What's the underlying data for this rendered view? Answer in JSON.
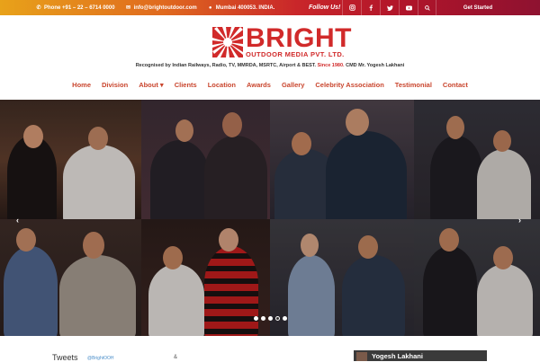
{
  "topbar": {
    "phone": "Phone +91 – 22 – 6714 0000",
    "email": "info@brightoutdoor.com",
    "address": "Mumbai 400053. INDIA.",
    "follow_us": "Follow Us!",
    "socials": [
      "instagram-icon",
      "facebook-icon",
      "twitter-icon",
      "youtube-icon",
      "search-icon"
    ],
    "get_started": "Get Started"
  },
  "header": {
    "brand": "BRIGHT",
    "brand_sub": "OUTDOOR MEDIA PVT. LTD.",
    "tagline_pre": "Recognised by Indian Railways, Radio, TV, MMRDA, MSRTC, Airport & BEST.",
    "tagline_since": "Since 1980.",
    "tagline_post": "CMD Mr. Yogesh Lakhani"
  },
  "nav": {
    "items": [
      "Home",
      "Division",
      "About ▾",
      "Clients",
      "Location",
      "Awards",
      "Gallery",
      "Celebrity Association",
      "Testimonial",
      "Contact"
    ]
  },
  "slider": {
    "prev": "‹",
    "next": "›",
    "active_slide": 4,
    "slide_count": 5
  },
  "bottom": {
    "tweets_title": "Tweets",
    "tweets_handle": "@BrightOOH",
    "tweets_icon": "hashtag",
    "ig_name": "Yogesh Lakhani"
  },
  "colors": {
    "brand_red": "#d12a2a",
    "nav_text": "#c9452d"
  }
}
